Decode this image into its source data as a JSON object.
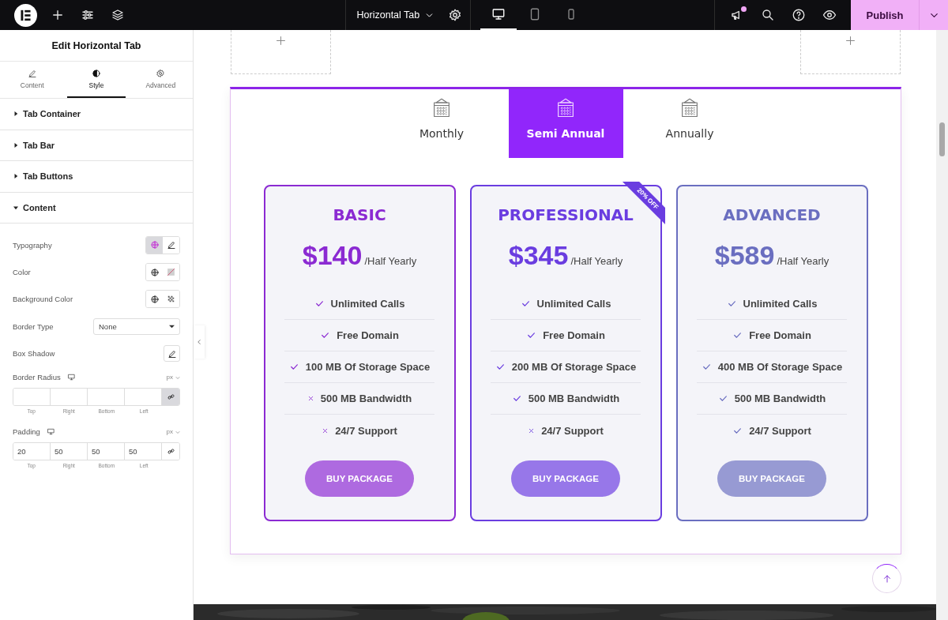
{
  "topbar": {
    "document_title": "Horizontal Tab",
    "devices": [
      {
        "kind": "desktop",
        "selected": true
      },
      {
        "kind": "tablet",
        "selected": false
      },
      {
        "kind": "mobile",
        "selected": false
      }
    ],
    "has_notification": true,
    "publish": "Publish"
  },
  "panel": {
    "title": "Edit Horizontal Tab",
    "tabs": [
      {
        "label": "Content",
        "selected": false
      },
      {
        "label": "Style",
        "selected": true
      },
      {
        "label": "Advanced",
        "selected": false
      }
    ],
    "sections": [
      {
        "label": "Tab Container",
        "expanded": false
      },
      {
        "label": "Tab Bar",
        "expanded": false
      },
      {
        "label": "Tab Buttons",
        "expanded": false
      },
      {
        "label": "Content",
        "expanded": true
      }
    ],
    "controls": [
      {
        "kind": "typography",
        "label": "Typography",
        "global_active": true
      },
      {
        "kind": "color",
        "label": "Color",
        "global_active": false
      },
      {
        "kind": "background",
        "label": "Background Color",
        "global_active": false
      },
      {
        "kind": "select",
        "label": "Border Type",
        "value": "None"
      },
      {
        "kind": "popover",
        "label": "Box Shadow"
      },
      {
        "kind": "dimensions",
        "label": "Border Radius",
        "unit": "px",
        "linked": true,
        "fields": [
          {
            "label": "Top"
          },
          {
            "label": "Right"
          },
          {
            "label": "Bottom"
          },
          {
            "label": "Left"
          }
        ]
      },
      {
        "kind": "dimensions",
        "label": "Padding",
        "unit": "px",
        "linked": false,
        "fields": [
          {
            "label": "Top",
            "value": "20"
          },
          {
            "label": "Right",
            "value": "50"
          },
          {
            "label": "Bottom",
            "value": "50"
          },
          {
            "label": "Left",
            "value": "50"
          }
        ]
      }
    ]
  },
  "canvas": {
    "tabs": [
      {
        "label": "Monthly",
        "selected": false
      },
      {
        "label": "Semi Annual",
        "selected": true
      },
      {
        "label": "Annually",
        "selected": false
      }
    ],
    "plans": [
      {
        "name": "BASIC",
        "price": "$140",
        "period": "/Half Yearly",
        "color": "#8b2ad2",
        "button": "BUY PACKAGE",
        "features": [
          {
            "text": "Unlimited Calls",
            "included": true
          },
          {
            "text": "Free Domain",
            "included": true
          },
          {
            "text": "100 MB Of Storage Space",
            "included": true
          },
          {
            "text": "500 MB Bandwidth",
            "included": false
          },
          {
            "text": "24/7 Support",
            "included": false
          }
        ]
      },
      {
        "name": "PROFESSIONAL",
        "price": "$345",
        "period": "/Half Yearly",
        "color": "#6a3de0",
        "badge": "20% OFF",
        "button": "BUY PACKAGE",
        "features": [
          {
            "text": "Unlimited Calls",
            "included": true
          },
          {
            "text": "Free Domain",
            "included": true
          },
          {
            "text": "200 MB Of Storage Space",
            "included": true
          },
          {
            "text": "500 MB Bandwidth",
            "included": true
          },
          {
            "text": "24/7 Support",
            "included": false
          }
        ]
      },
      {
        "name": "ADVANCED",
        "price": "$589",
        "period": "/Half Yearly",
        "color": "#6a6ec0",
        "button": "BUY PACKAGE",
        "features": [
          {
            "text": "Unlimited Calls",
            "included": true
          },
          {
            "text": "Free Domain",
            "included": true
          },
          {
            "text": "400 MB Of Storage Space",
            "included": true
          },
          {
            "text": "500 MB Bandwidth",
            "included": true
          },
          {
            "text": "24/7 Support",
            "included": true
          }
        ]
      }
    ]
  }
}
